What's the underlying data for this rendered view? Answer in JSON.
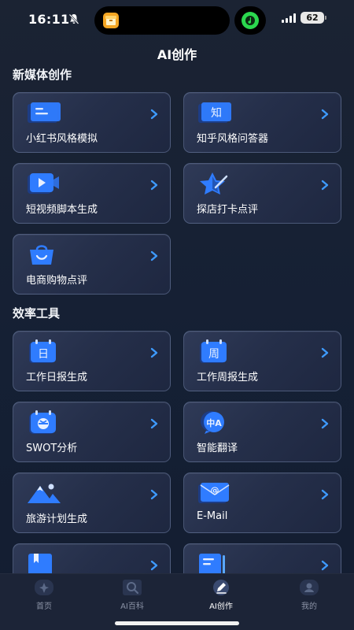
{
  "status": {
    "time": "16:11",
    "battery": "62"
  },
  "header": {
    "title": "AI创作"
  },
  "sections": {
    "media": {
      "title": "新媒体创作"
    },
    "efficiency": {
      "title": "效率工具"
    }
  },
  "cards": {
    "xiaohongshu": {
      "label": "小红书风格模拟",
      "icon": "notebook-icon"
    },
    "zhihu": {
      "label": "知乎风格问答器",
      "icon": "zhi-icon",
      "glyph": "知"
    },
    "video_script": {
      "label": "短视频脚本生成",
      "icon": "video-play-icon"
    },
    "shop_review": {
      "label": "探店打卡点评",
      "icon": "star-icon"
    },
    "ecommerce": {
      "label": "电商购物点评",
      "icon": "shopping-bag-icon"
    },
    "daily_report": {
      "label": "工作日报生成",
      "icon": "calendar-day-icon",
      "glyph": "日"
    },
    "weekly_report": {
      "label": "工作周报生成",
      "icon": "calendar-week-icon",
      "glyph": "周"
    },
    "swot": {
      "label": "SWOT分析",
      "icon": "swot-calendar-icon"
    },
    "translate": {
      "label": "智能翻译",
      "icon": "translate-icon",
      "glyph": "中A"
    },
    "travel": {
      "label": "旅游计划生成",
      "icon": "mountain-icon"
    },
    "email": {
      "label": "E-Mail",
      "icon": "email-icon",
      "glyph": "@"
    }
  },
  "tabs": [
    {
      "label": "首页",
      "icon": "home-icon",
      "active": false
    },
    {
      "label": "AI百科",
      "icon": "search-book-icon",
      "active": false
    },
    {
      "label": "AI创作",
      "icon": "pen-icon",
      "active": true
    },
    {
      "label": "我的",
      "icon": "profile-icon",
      "active": false
    }
  ],
  "colors": {
    "accent": "#2f8cff",
    "background": "#172033",
    "card": "#2a3450"
  }
}
